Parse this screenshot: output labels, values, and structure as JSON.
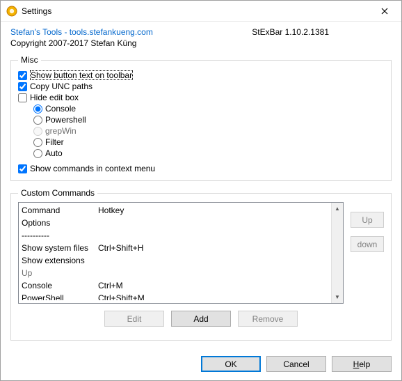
{
  "window": {
    "title": "Settings"
  },
  "header": {
    "link_text": "Stefan's Tools - tools.stefankueng.com",
    "version": "StExBar 1.10.2.1381",
    "copyright": "Copyright 2007-2017 Stefan Küng"
  },
  "misc": {
    "legend": "Misc",
    "show_button_text": {
      "label": "Show button text on toolbar",
      "checked": true,
      "focused": true
    },
    "copy_unc": {
      "label": "Copy UNC paths",
      "checked": true
    },
    "hide_edit": {
      "label": "Hide edit box",
      "checked": false
    },
    "radio": {
      "console": {
        "label": "Console",
        "selected": true,
        "enabled": true
      },
      "powershell": {
        "label": "Powershell",
        "selected": false,
        "enabled": true
      },
      "grepwin": {
        "label": "grepWin",
        "selected": false,
        "enabled": false
      },
      "filter": {
        "label": "Filter",
        "selected": false,
        "enabled": true
      },
      "auto": {
        "label": "Auto",
        "selected": false,
        "enabled": true
      }
    },
    "show_context": {
      "label": "Show commands in context menu",
      "checked": true
    }
  },
  "custom": {
    "legend": "Custom Commands",
    "columns": {
      "command": "Command",
      "hotkey": "Hotkey"
    },
    "items": [
      {
        "command": "Options",
        "hotkey": "",
        "faded": false
      },
      {
        "command": "----------",
        "hotkey": "",
        "faded": false
      },
      {
        "command": "Show system files",
        "hotkey": "Ctrl+Shift+H",
        "faded": false
      },
      {
        "command": "Show extensions",
        "hotkey": "",
        "faded": false
      },
      {
        "command": "Up",
        "hotkey": "",
        "faded": true
      },
      {
        "command": "Console",
        "hotkey": "Ctrl+M",
        "faded": false
      },
      {
        "command": "PowerShell",
        "hotkey": "Ctrl+Shift+M",
        "faded": false,
        "clipped": true
      }
    ],
    "side": {
      "up": "Up",
      "down": "down"
    },
    "buttons": {
      "edit": "Edit",
      "add": "Add",
      "remove": "Remove"
    }
  },
  "dialog_buttons": {
    "ok": "OK",
    "cancel": "Cancel",
    "help": "Help"
  }
}
